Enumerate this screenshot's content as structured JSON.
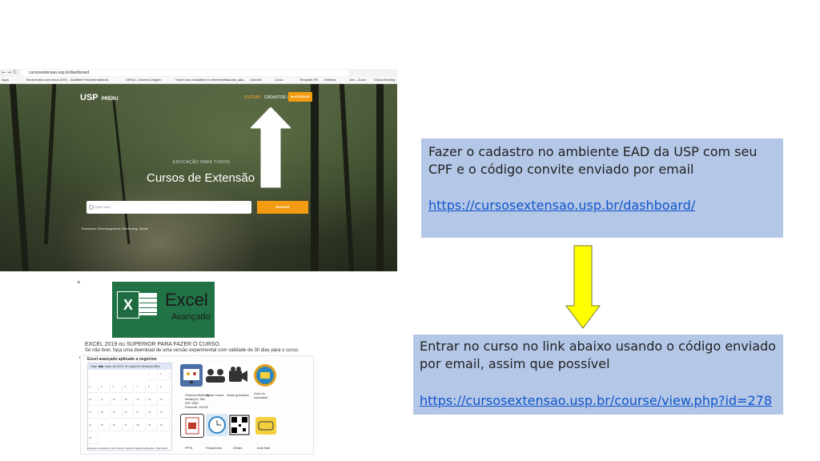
{
  "browser": {
    "url": "cursosextensao.usp.br/dashboard",
    "bookmarks": [
      "Apps",
      "ferramentas.com",
      "Inbox (497) - dulce",
      "Web Ferramentas",
      "Tools",
      "XENIA - Universi...",
      "Viagem",
      "Sobre meu celular",
      "How to determine t...",
      "Doudas_sala",
      "Linkedin",
      "Curso",
      "Template-PB",
      "Webinar",
      "Join - Zoom",
      "Global Nursing"
    ],
    "nav_back": "←",
    "nav_fwd": "→",
    "nav_reload": "C"
  },
  "site": {
    "logo": "USP",
    "logo_sub": "PRÉRU",
    "nav_entrar": "ENTRAR",
    "nav_cadastre": "CADASTRE-SE",
    "btn_acessar": "■ ACESSAR",
    "edu_tag": "EDUCAÇÃO PARA TODOS",
    "hero_title": "Cursos de Extensão",
    "search_placeholder": "Digite aqui...",
    "btn_buscar": "BUSCAR",
    "exemplos": "Exemplos: Dermatogramas, Monitoring, Saúde"
  },
  "excel": {
    "plus": "+",
    "word": "Excel",
    "sub": "Avançado",
    "x_letter": "X",
    "line1": "EXCEL 2019 ou SUPERIOR PARA FAZER O CURSO.",
    "line2": "Se não tiver, faça uma download de uma versão experimental com validade de 30 dias para o curso."
  },
  "course_thumb": {
    "plus": "+",
    "title": "Excel avançado aplicado a negócios",
    "calendar_header": "Hoje  ◀ ▶  maio de 2021  ⊕ Imprimir  Semana  Mês",
    "calendar_days": [
      "1",
      "2",
      "3",
      "4",
      "5",
      "6",
      "7",
      "8",
      "9",
      "10",
      "11",
      "12",
      "13",
      "14",
      "15",
      "16",
      "17",
      "18",
      "19",
      "20",
      "21",
      "22",
      "23",
      "24",
      "25",
      "26",
      "27",
      "28",
      "29",
      "30",
      "31"
    ],
    "calendar_footer": "Eventos mostrados no fuso horário: Horário Padrão de Brasília - São Paulo",
    "tile_labels": [
      "Videoconferência",
      "Ajude mútua",
      "Aulas gravadas",
      "Guia do estudante",
      "PPTs",
      "Frequência",
      "Whats",
      "Aval final"
    ],
    "vc_text": [
      "Meeting ID: 883",
      "5307 6363",
      "Passcode: 101010"
    ]
  },
  "box1": {
    "text": "Fazer o cadastro no ambiente EAD da USP com seu CPF e o código convite enviado por email",
    "link": "https://cursosextensao.usp.br/dashboard/"
  },
  "box2": {
    "text": "Entrar no curso no link abaixo usando o código enviado por email, assim que possível",
    "link": "https://cursosextensao.usp.br/course/view.php?id=278"
  },
  "colors": {
    "box_bg": "#b4c7e7",
    "link": "#1155cc",
    "arrow_yellow": "#ffff00",
    "excel_green": "#217346",
    "accent_orange": "#f39c12"
  }
}
